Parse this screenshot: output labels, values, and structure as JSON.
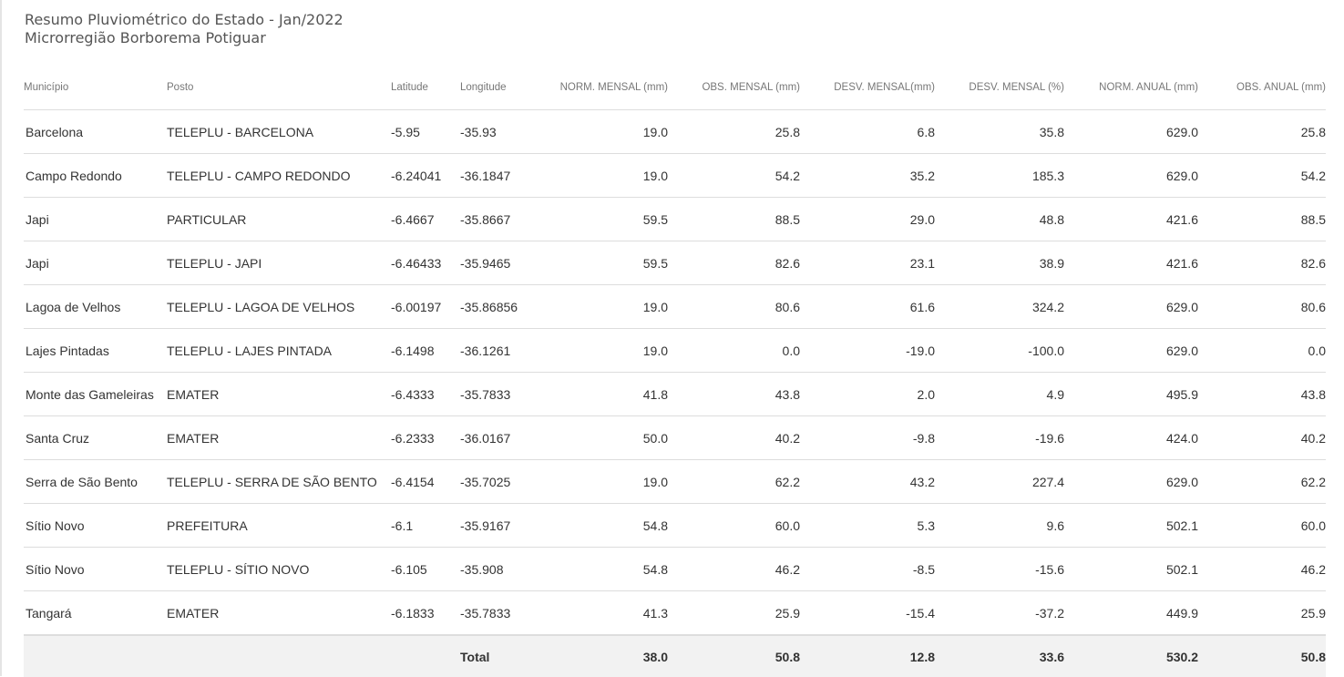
{
  "title": {
    "line1": "Resumo Pluviométrico do Estado - Jan/2022",
    "line2": "Microrregião Borborema Potiguar"
  },
  "table": {
    "headers": {
      "municipio": "Município",
      "posto": "Posto",
      "latitude": "Latitude",
      "longitude": "Longitude",
      "norm_mensal": "NORM. MENSAL (mm)",
      "obs_mensal": "OBS. MENSAL (mm)",
      "desv_mensal_mm": "DESV. MENSAL(mm)",
      "desv_mensal_pct": "DESV. MENSAL (%)",
      "norm_anual": "NORM. ANUAL (mm)",
      "obs_anual": "OBS. ANUAL (mm)"
    },
    "rows": [
      [
        "Barcelona",
        "TELEPLU - BARCELONA",
        "-5.95",
        "-35.93",
        "19.0",
        "25.8",
        "6.8",
        "35.8",
        "629.0",
        "25.8"
      ],
      [
        "Campo Redondo",
        "TELEPLU - CAMPO REDONDO",
        "-6.24041",
        "-36.1847",
        "19.0",
        "54.2",
        "35.2",
        "185.3",
        "629.0",
        "54.2"
      ],
      [
        "Japi",
        "PARTICULAR",
        "-6.4667",
        "-35.8667",
        "59.5",
        "88.5",
        "29.0",
        "48.8",
        "421.6",
        "88.5"
      ],
      [
        "Japi",
        "TELEPLU - JAPI",
        "-6.46433",
        "-35.9465",
        "59.5",
        "82.6",
        "23.1",
        "38.9",
        "421.6",
        "82.6"
      ],
      [
        "Lagoa de Velhos",
        "TELEPLU - LAGOA DE VELHOS",
        "-6.00197",
        "-35.86856",
        "19.0",
        "80.6",
        "61.6",
        "324.2",
        "629.0",
        "80.6"
      ],
      [
        "Lajes Pintadas",
        "TELEPLU - LAJES PINTADA",
        "-6.1498",
        "-36.1261",
        "19.0",
        "0.0",
        "-19.0",
        "-100.0",
        "629.0",
        "0.0"
      ],
      [
        "Monte das Gameleiras",
        "EMATER",
        "-6.4333",
        "-35.7833",
        "41.8",
        "43.8",
        "2.0",
        "4.9",
        "495.9",
        "43.8"
      ],
      [
        "Santa Cruz",
        "EMATER",
        "-6.2333",
        "-36.0167",
        "50.0",
        "40.2",
        "-9.8",
        "-19.6",
        "424.0",
        "40.2"
      ],
      [
        "Serra de São Bento",
        "TELEPLU - SERRA DE SÃO BENTO",
        "-6.4154",
        "-35.7025",
        "19.0",
        "62.2",
        "43.2",
        "227.4",
        "629.0",
        "62.2"
      ],
      [
        "Sítio Novo",
        "PREFEITURA",
        "-6.1",
        "-35.9167",
        "54.8",
        "60.0",
        "5.3",
        "9.6",
        "502.1",
        "60.0"
      ],
      [
        "Sítio Novo",
        "TELEPLU - SÍTIO NOVO",
        "-6.105",
        "-35.908",
        "54.8",
        "46.2",
        "-8.5",
        "-15.6",
        "502.1",
        "46.2"
      ],
      [
        "Tangará",
        "EMATER",
        "-6.1833",
        "-35.7833",
        "41.3",
        "25.9",
        "-15.4",
        "-37.2",
        "449.9",
        "25.9"
      ]
    ],
    "total": {
      "label": "Total",
      "norm_mensal": "38.0",
      "obs_mensal": "50.8",
      "desv_mensal_mm": "12.8",
      "desv_mensal_pct": "33.6",
      "norm_anual": "530.2",
      "obs_anual": "50.8"
    }
  }
}
